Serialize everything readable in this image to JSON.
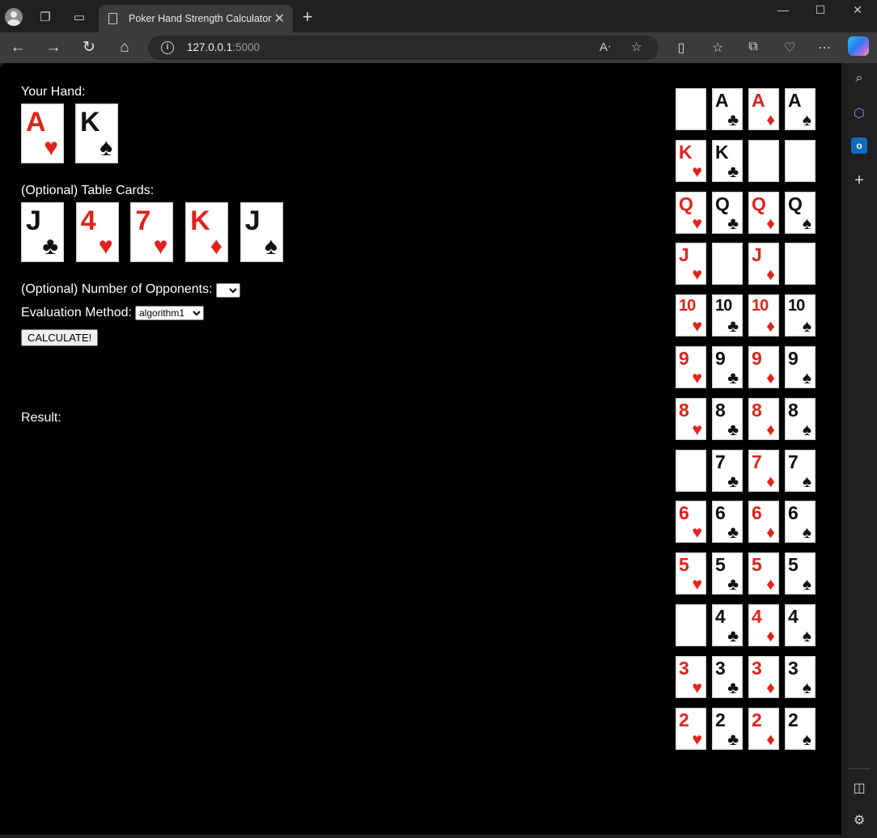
{
  "browser": {
    "tab_title": "Poker Hand Strength Calculator",
    "url_host": "127.0.0.1",
    "url_port": ":5000"
  },
  "page": {
    "hand_label": "Your Hand:",
    "table_label": "(Optional) Table Cards:",
    "opponents_label": "(Optional) Number of Opponents:",
    "opponents_value": "",
    "method_label": "Evaluation Method:",
    "method_value": "algorithm1",
    "calculate_label": "CALCULATE!",
    "result_label": "Result:"
  },
  "hand_cards": [
    {
      "rank": "A",
      "suit": "hearts"
    },
    {
      "rank": "K",
      "suit": "spades"
    }
  ],
  "table_cards": [
    {
      "rank": "J",
      "suit": "clubs"
    },
    {
      "rank": "4",
      "suit": "hearts"
    },
    {
      "rank": "7",
      "suit": "hearts"
    },
    {
      "rank": "K",
      "suit": "diamonds"
    },
    {
      "rank": "J",
      "suit": "spades"
    }
  ],
  "deck_suits": [
    "hearts",
    "clubs",
    "diamonds",
    "spades"
  ],
  "deck_rows": [
    {
      "rank": "A",
      "cards": [
        null,
        "A",
        "A",
        "A"
      ]
    },
    {
      "rank": "K",
      "cards": [
        "K",
        "K",
        null,
        null
      ]
    },
    {
      "rank": "Q",
      "cards": [
        "Q",
        "Q",
        "Q",
        "Q"
      ]
    },
    {
      "rank": "J",
      "cards": [
        "J",
        null,
        "J",
        null
      ]
    },
    {
      "rank": "10",
      "cards": [
        "10",
        "10",
        "10",
        "10"
      ]
    },
    {
      "rank": "9",
      "cards": [
        "9",
        "9",
        "9",
        "9"
      ]
    },
    {
      "rank": "8",
      "cards": [
        "8",
        "8",
        "8",
        "8"
      ]
    },
    {
      "rank": "7",
      "cards": [
        null,
        "7",
        "7",
        "7"
      ]
    },
    {
      "rank": "6",
      "cards": [
        "6",
        "6",
        "6",
        "6"
      ]
    },
    {
      "rank": "5",
      "cards": [
        "5",
        "5",
        "5",
        "5"
      ]
    },
    {
      "rank": "4",
      "cards": [
        null,
        "4",
        "4",
        "4"
      ]
    },
    {
      "rank": "3",
      "cards": [
        "3",
        "3",
        "3",
        "3"
      ]
    },
    {
      "rank": "2",
      "cards": [
        "2",
        "2",
        "2",
        "2"
      ]
    }
  ],
  "suit_glyphs": {
    "hearts": "♥",
    "diamonds": "♦",
    "clubs": "♣",
    "spades": "♠"
  },
  "colors": {
    "red_suit": "#e2231a",
    "black_suit": "#111111",
    "page_bg": "#000000"
  }
}
